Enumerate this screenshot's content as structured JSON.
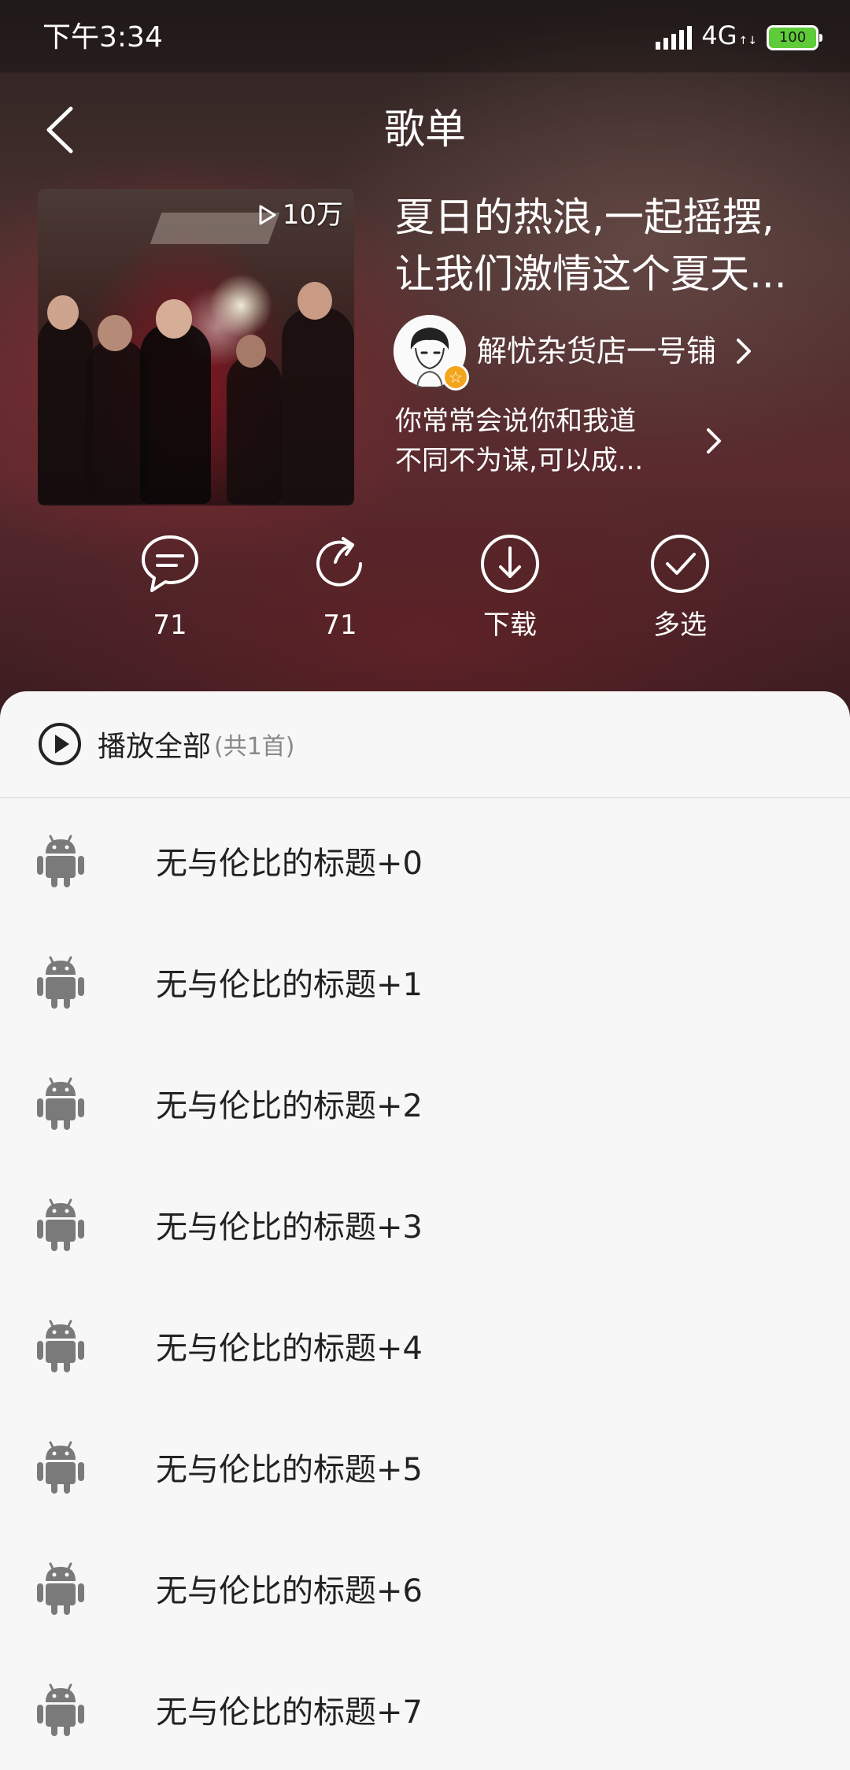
{
  "status_bar": {
    "time": "下午3:34",
    "network": "4G",
    "network_sub": "↑↓",
    "battery": "100"
  },
  "header": {
    "title": "歌单"
  },
  "playlist": {
    "play_count": "10万",
    "title_line1": "夏日的热浪,一起摇摆,",
    "title_line2": "让我们激情这个夏天...",
    "creator_name": "解忧杂货店一号铺",
    "desc_line1": "你常常会说你和我道",
    "desc_line2": "不同不为谋,可以成..."
  },
  "actions": {
    "comment_count": "71",
    "share_count": "71",
    "download_label": "下载",
    "multiselect_label": "多选"
  },
  "play_all": {
    "label": "播放全部",
    "count": "(共1首)"
  },
  "songs": [
    {
      "title": "无与伦比的标题+0"
    },
    {
      "title": "无与伦比的标题+1"
    },
    {
      "title": "无与伦比的标题+2"
    },
    {
      "title": "无与伦比的标题+3"
    },
    {
      "title": "无与伦比的标题+4"
    },
    {
      "title": "无与伦比的标题+5"
    },
    {
      "title": "无与伦比的标题+6"
    },
    {
      "title": "无与伦比的标题+7"
    }
  ],
  "colors": {
    "avatar_badge": "#f3a51b",
    "battery": "#5ecb38",
    "song_icon": "#7a7a7a"
  },
  "icons": {
    "back": "back-arrow-icon",
    "play_count": "play-triangle-icon",
    "comment": "comment-bubble-icon",
    "share": "share-arrow-icon",
    "download": "download-circle-icon",
    "multiselect": "check-circle-icon",
    "play_all": "play-circle-icon",
    "song": "android-icon"
  }
}
